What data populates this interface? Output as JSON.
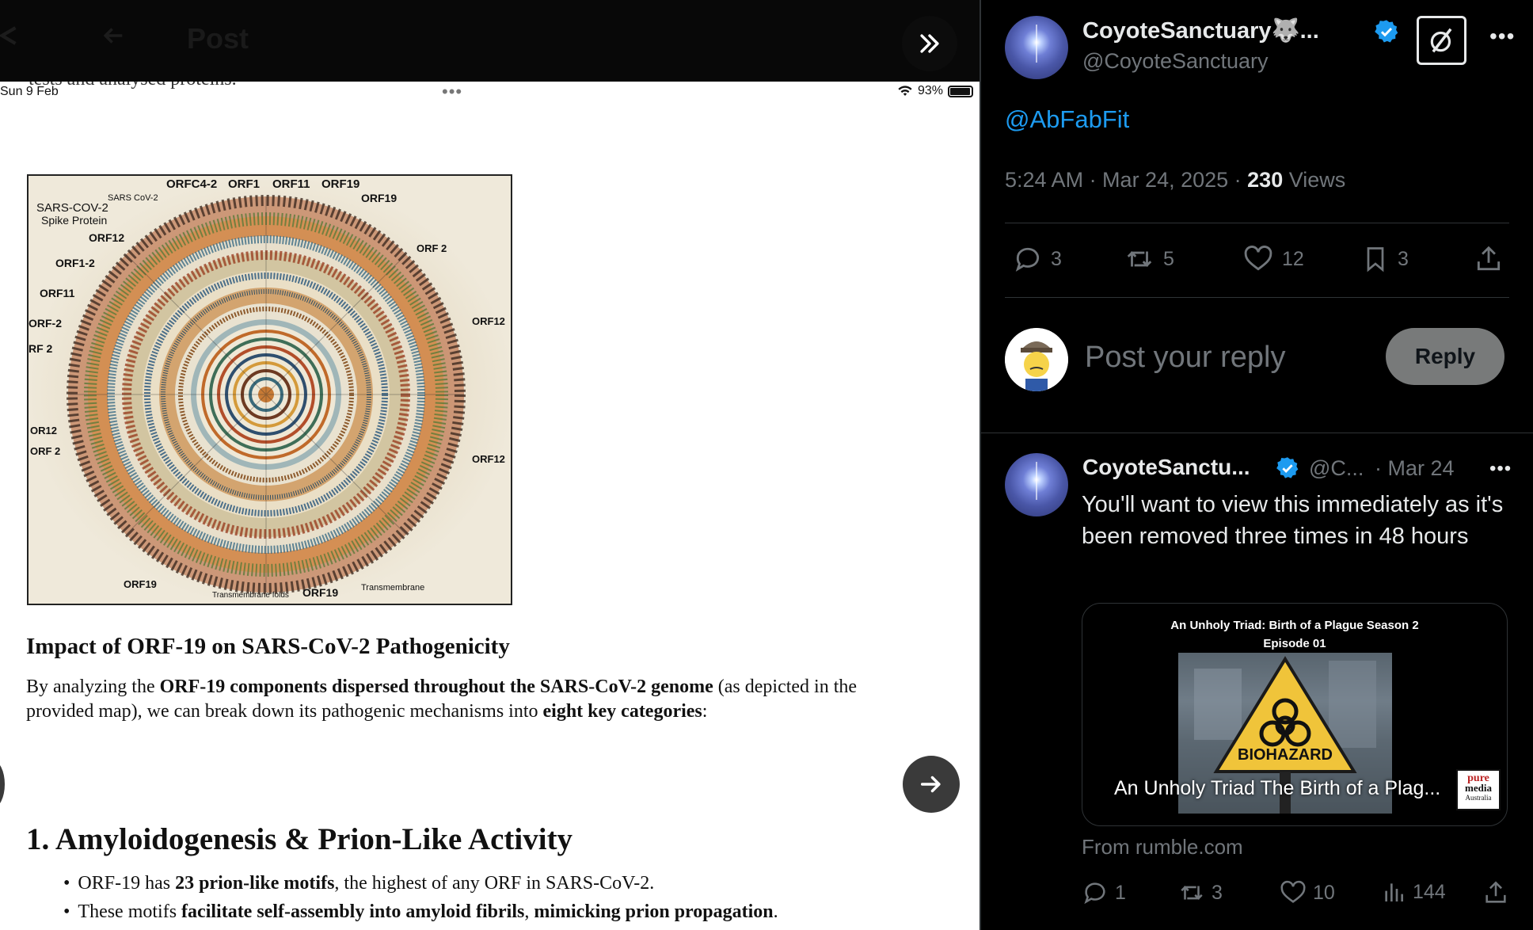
{
  "top_bar": {
    "title": "Post"
  },
  "device_status": {
    "time": "Sun 9 Feb",
    "clipped_text": "tests and analysed proteins.",
    "battery": "93%"
  },
  "figure": {
    "labels": [
      "ORFC4-2",
      "ORF1",
      "ORF11",
      "ORF19",
      "SARS CoV-2",
      "ORF19",
      "SARS-COV-2",
      "Spike Protein",
      "ORF12",
      "ORF1-2",
      "ORF11",
      "ORF-2",
      "RF 2",
      "OR12",
      "ORF 2",
      "ORF 2",
      "ORF12",
      "ORF12",
      "ORF19",
      "Transmembrane folds",
      "ORF19",
      "Transmembrane"
    ]
  },
  "article": {
    "heading": "Impact of ORF-19 on SARS-CoV-2 Pathogenicity",
    "para_prefix": "By analyzing the ",
    "para_bold1": "ORF-19 components dispersed throughout the SARS-CoV-2 genome",
    "para_mid": " (as depicted in the provided map), we can break down its pathogenic mechanisms into ",
    "para_bold2": "eight key categories",
    "para_suffix": ":",
    "section_title": "1. Amyloidogenesis & Prion-Like Activity",
    "bullet1_a": "ORF-19 has ",
    "bullet1_b": "23 prion-like motifs",
    "bullet1_c": ", the highest of any ORF in SARS-CoV-2.",
    "bullet2_a": "These motifs ",
    "bullet2_b": "facilitate self-assembly into amyloid fibrils",
    "bullet2_c": ", ",
    "bullet2_d": "mimicking prion propagation",
    "bullet2_e": "."
  },
  "post": {
    "author_name": "CoyoteSanctuary🐺...",
    "author_handle": "@CoyoteSanctuary",
    "mention": "@AbFabFit",
    "time": "5:24 AM · Mar 24, 2025 · ",
    "views_count": "230",
    "views_label": " Views",
    "replies": "3",
    "reposts": "5",
    "likes": "12",
    "bookmarks": "3"
  },
  "reply_box": {
    "placeholder": "Post your reply",
    "button": "Reply"
  },
  "quoted_reply": {
    "author_name": "CoyoteSanctu...",
    "handle": "@C...",
    "date": "· Mar 24",
    "text": "You'll want to view this immediately as it's been removed three times in 48 hours",
    "card_title_1": "An Unholy Triad: Birth of a Plague Season 2",
    "card_title_2": "Episode 01",
    "card_sign": "BIOHAZARD",
    "card_caption": "An Unholy Triad The Birth of a Plag...",
    "card_logo_1": "pure",
    "card_logo_2": "media",
    "card_logo_3": "Australia",
    "source": "From rumble.com",
    "replies": "1",
    "reposts": "3",
    "likes": "10",
    "views": "144"
  },
  "colors": {
    "accent": "#1d9bf0",
    "muted": "#71767b",
    "reply_button": "#787a7a"
  }
}
